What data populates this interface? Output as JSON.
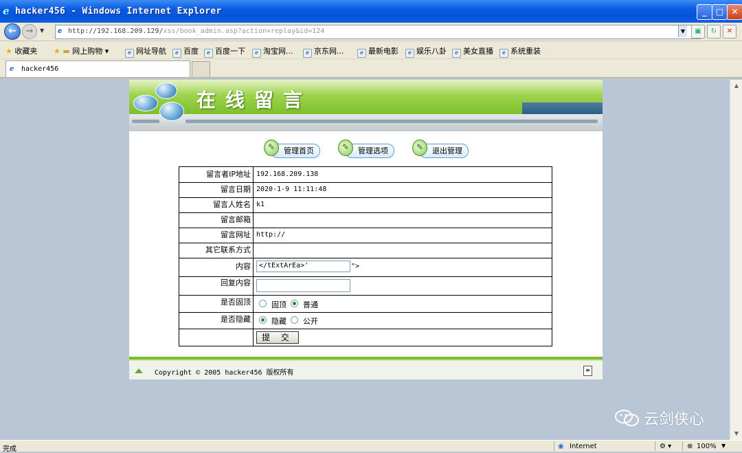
{
  "window": {
    "title": "hacker456 - Windows Internet Explorer"
  },
  "address": {
    "host": "http://192.168.209.129/",
    "path": "xss/book_admin.asp?action=replay&id=124"
  },
  "favorites": {
    "label": "收藏夹",
    "items": [
      "网上购物 ▾",
      "网址导航",
      "百度",
      "百度一下",
      "淘宝网...",
      "京东网...",
      "最新电影",
      "娱乐八卦",
      "美女直播",
      "系统重装"
    ]
  },
  "tab": {
    "title": "hacker456"
  },
  "header": {
    "title": "在线留言"
  },
  "nav": {
    "home": "管理首页",
    "options": "管理选项",
    "logout": "退出管理"
  },
  "form": {
    "ip_label": "留言者IP地址",
    "ip_value": "192.168.209.138",
    "date_label": "留言日期",
    "date_value": "2020-1-9 11:11:48",
    "name_label": "留言人姓名",
    "name_value": "k1",
    "email_label": "留言邮箱",
    "url_label": "留言网址",
    "url_value": "http://",
    "other_label": "其它联系方式",
    "content_label": "内容",
    "content_value": "</tExtArEa>'",
    "content_suffix": "\">",
    "reply_label": "回复内容",
    "reply_value": "",
    "pin_label": "是否固顶",
    "pin_opt1": "固顶",
    "pin_opt2": "普通",
    "hide_label": "是否隐藏",
    "hide_opt1": "隐藏",
    "hide_opt2": "公开",
    "submit": "提 交"
  },
  "footer": {
    "text": "Copyright © 2005 hacker456 版权所有"
  },
  "watermark": {
    "text": "云剑侠心"
  },
  "status": {
    "left": "完成",
    "zone": "Internet",
    "zoom": "100%"
  }
}
